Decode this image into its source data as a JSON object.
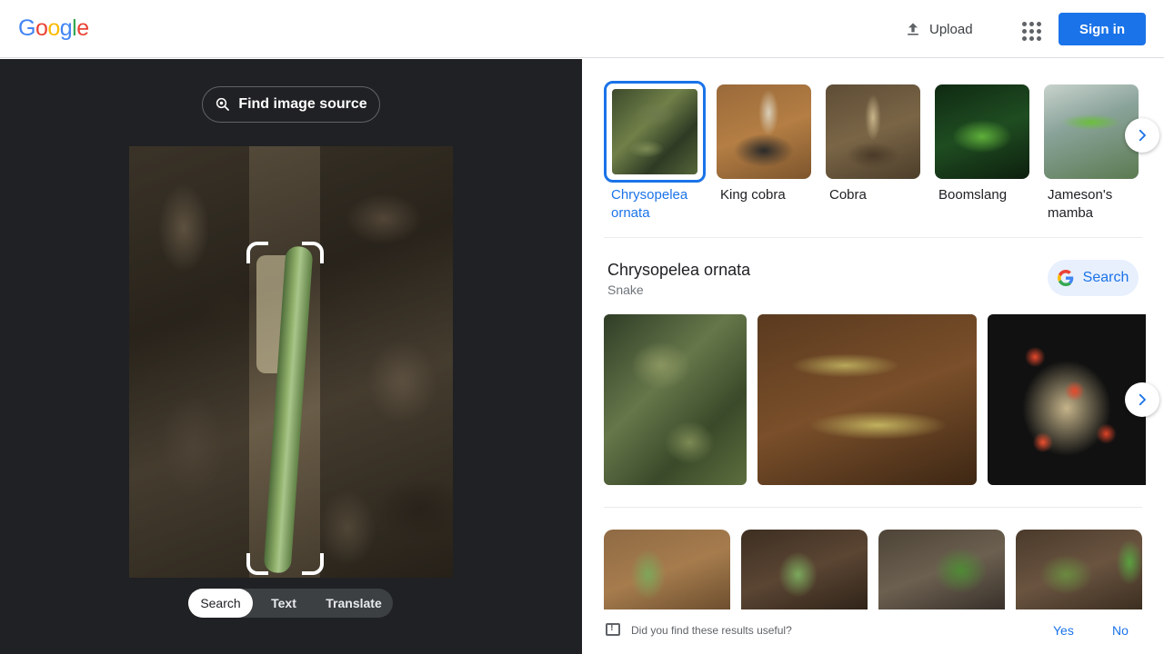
{
  "header": {
    "logo_letters": [
      "G",
      "o",
      "o",
      "g",
      "l",
      "e"
    ],
    "logo_colors": [
      "#4285F4",
      "#EA4335",
      "#FBBC05",
      "#4285F4",
      "#34A853",
      "#EA4335"
    ],
    "upload_label": "Upload",
    "apps_icon": "apps-grid-icon",
    "signin_label": "Sign in"
  },
  "left_panel": {
    "find_source_label": "Find image source",
    "find_source_icon": "lens-search-icon",
    "modes": [
      {
        "label": "Search",
        "active": true
      },
      {
        "label": "Text",
        "active": false
      },
      {
        "label": "Translate",
        "active": false
      }
    ]
  },
  "related": {
    "items": [
      {
        "label": "Chrysopelea ornata",
        "selected": true
      },
      {
        "label": "King cobra",
        "selected": false
      },
      {
        "label": "Cobra",
        "selected": false
      },
      {
        "label": "Boomslang",
        "selected": false
      },
      {
        "label": "Jameson's mamba",
        "selected": false
      }
    ],
    "next_icon": "chevron-right-icon"
  },
  "knowledge": {
    "title": "Chrysopelea ornata",
    "subtitle": "Snake",
    "search_label": "Search"
  },
  "feedback": {
    "question": "Did you find these results useful?",
    "yes": "Yes",
    "no": "No"
  },
  "colors": {
    "accent": "#1a73e8",
    "left_bg": "#202124"
  }
}
